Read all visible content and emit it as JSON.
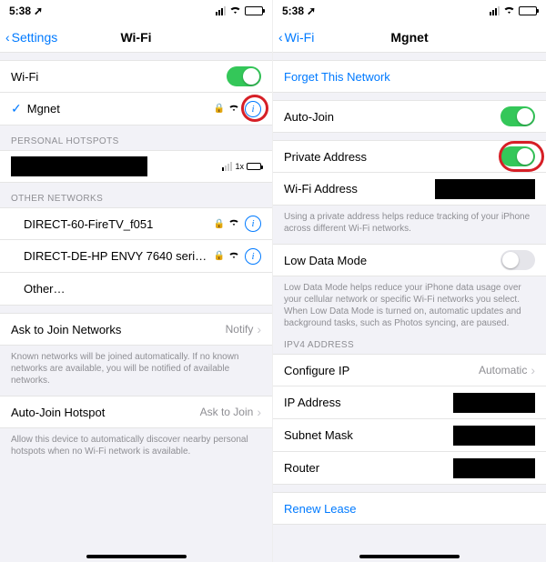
{
  "left": {
    "status": {
      "time": "5:38",
      "loc_arrow": "➚"
    },
    "nav": {
      "back": "Settings",
      "title": "Wi-Fi"
    },
    "wifi_row": {
      "label": "Wi-Fi"
    },
    "connected": {
      "name": "Mgnet"
    },
    "hotspots_header": "PERSONAL HOTSPOTS",
    "hotspot_1x": "1x",
    "other_header": "OTHER NETWORKS",
    "nets": [
      {
        "name": "DIRECT-60-FireTV_f051"
      },
      {
        "name": "DIRECT-DE-HP ENVY 7640 seri…"
      },
      {
        "name": "Other…"
      }
    ],
    "ask_join": {
      "label": "Ask to Join Networks",
      "value": "Notify"
    },
    "ask_join_note": "Known networks will be joined automatically. If no known networks are available, you will be notified of available networks.",
    "auto_hotspot": {
      "label": "Auto-Join Hotspot",
      "value": "Ask to Join"
    },
    "auto_hotspot_note": "Allow this device to automatically discover nearby personal hotspots when no Wi-Fi network is available."
  },
  "right": {
    "status": {
      "time": "5:38",
      "loc_arrow": "➚"
    },
    "nav": {
      "back": "Wi-Fi",
      "title": "Mgnet"
    },
    "forget": "Forget This Network",
    "auto_join": "Auto-Join",
    "private_addr": "Private Address",
    "wifi_addr_label": "Wi-Fi Address",
    "private_note": "Using a private address helps reduce tracking of your iPhone across different Wi-Fi networks.",
    "low_data": "Low Data Mode",
    "low_data_note": "Low Data Mode helps reduce your iPhone data usage over your cellular network or specific Wi-Fi networks you select. When Low Data Mode is turned on, automatic updates and background tasks, such as Photos syncing, are paused.",
    "ipv4_header": "IPV4 ADDRESS",
    "configure_ip": {
      "label": "Configure IP",
      "value": "Automatic"
    },
    "ip_addr": "IP Address",
    "subnet": "Subnet Mask",
    "router": "Router",
    "renew": "Renew Lease"
  }
}
